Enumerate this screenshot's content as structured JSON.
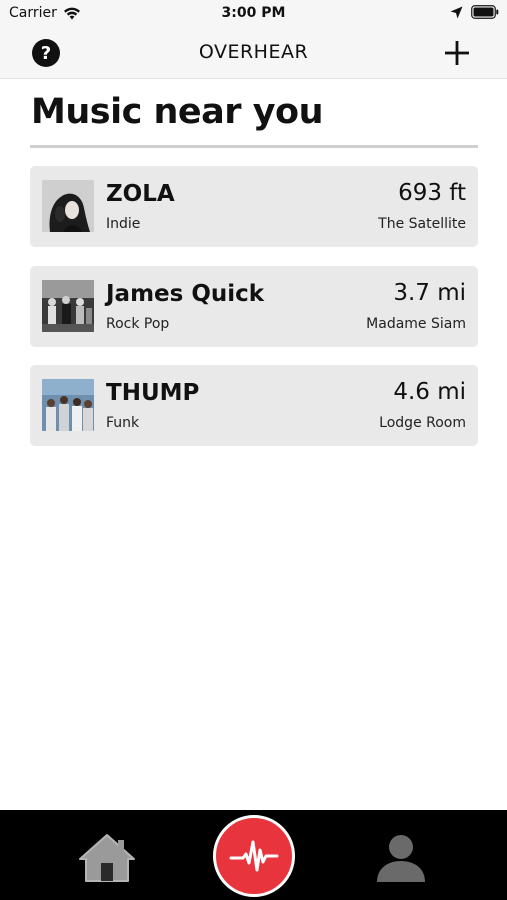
{
  "status_bar": {
    "carrier": "Carrier",
    "time": "3:00 PM"
  },
  "nav": {
    "title": "OVERHEAR",
    "help_label": "?"
  },
  "heading": "Music near you",
  "shows": [
    {
      "artist": "ZOLA",
      "genre": "Indie",
      "distance": "693 ft",
      "venue": "The Satellite"
    },
    {
      "artist": "James Quick",
      "genre": "Rock Pop",
      "distance": "3.7 mi",
      "venue": "Madame Siam"
    },
    {
      "artist": "THUMP",
      "genre": "Funk",
      "distance": "4.6 mi",
      "venue": "Lodge Room"
    }
  ],
  "tab_bar": {
    "items": [
      "home-icon",
      "waveform-icon",
      "profile-icon"
    ]
  },
  "colors": {
    "accent": "#e8343d",
    "card": "#e9e9e9",
    "tab_bar": "#000000"
  }
}
